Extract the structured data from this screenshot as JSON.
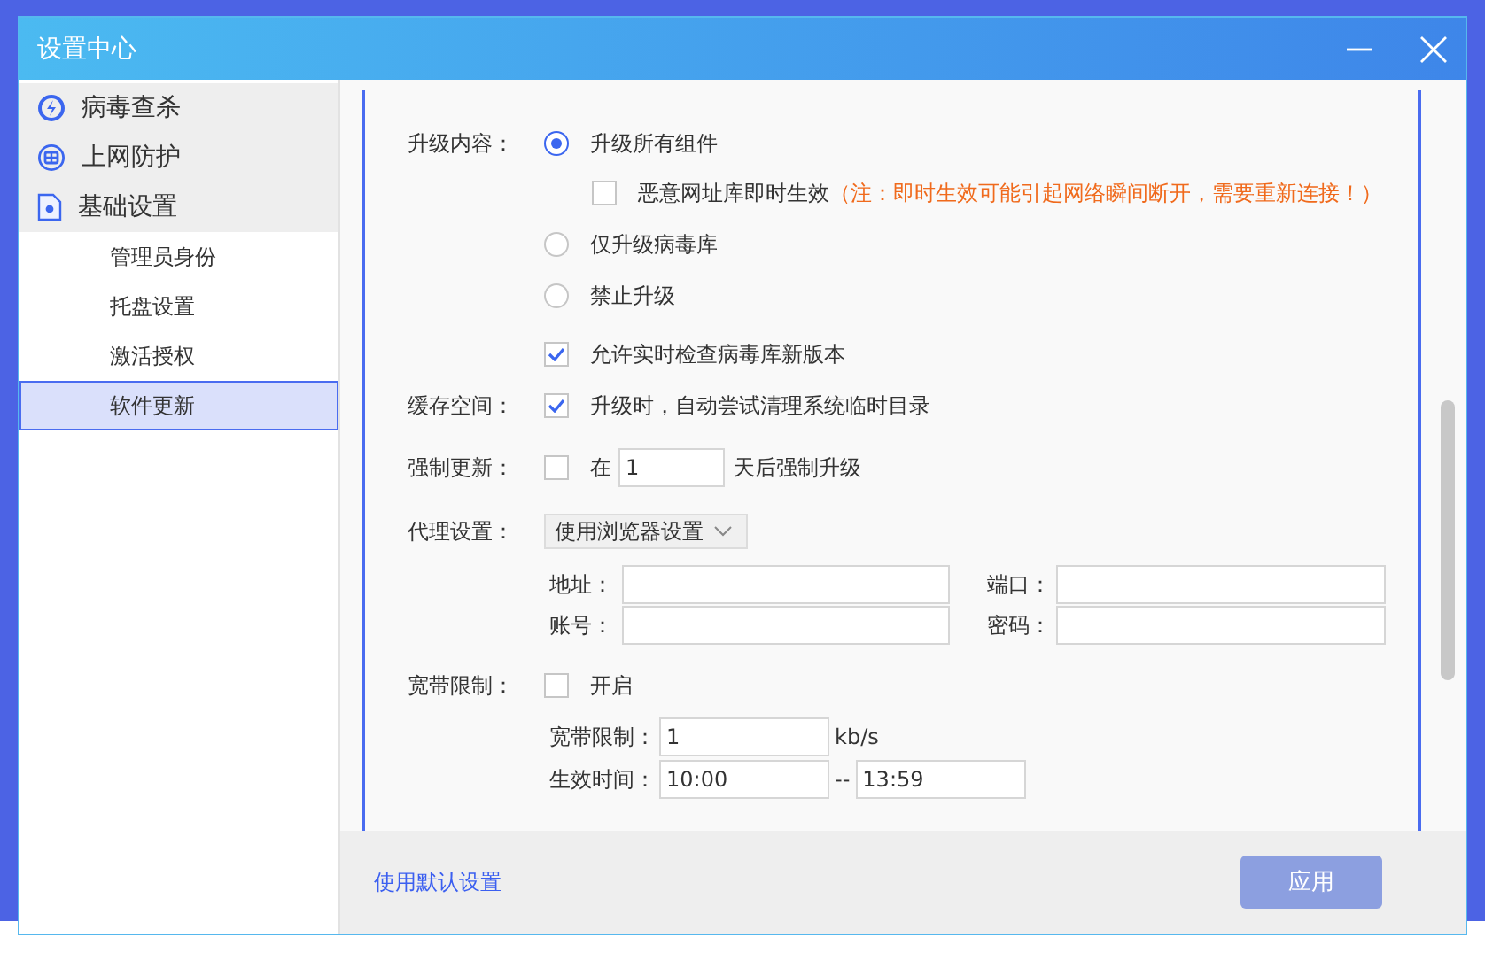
{
  "window": {
    "title": "设置中心"
  },
  "sidebar": {
    "groups": [
      {
        "label": "病毒查杀",
        "kind": "scan",
        "selected": false
      },
      {
        "label": "上网防护",
        "kind": "web",
        "selected": false
      },
      {
        "label": "基础设置",
        "kind": "basic",
        "selected": false,
        "children": [
          {
            "label": "管理员身份",
            "selected": false
          },
          {
            "label": "托盘设置",
            "selected": false
          },
          {
            "label": "激活授权",
            "selected": false
          },
          {
            "label": "软件更新",
            "selected": true
          }
        ]
      }
    ]
  },
  "upgrade_content": {
    "label": "升级内容：",
    "options": [
      {
        "label": "升级所有组件",
        "selected": true
      },
      {
        "label": "仅升级病毒库",
        "selected": false
      },
      {
        "label": "禁止升级",
        "selected": false
      }
    ],
    "realtime_url": {
      "label": "恶意网址库即时生效",
      "note": "（注：即时生效可能引起网络瞬间断开，需要重新连接！）",
      "checked": false
    },
    "realtime_check": {
      "label": "允许实时检查病毒库新版本",
      "checked": true
    }
  },
  "cache": {
    "label": "缓存空间：",
    "option": {
      "label": "升级时，自动尝试清理系统临时目录",
      "checked": true
    }
  },
  "force_update": {
    "label": "强制更新：",
    "checked": false,
    "prefix": "在",
    "days": "1",
    "suffix": "天后强制升级"
  },
  "proxy": {
    "label": "代理设置：",
    "mode": "使用浏览器设置",
    "fields": [
      {
        "label": "地址："
      },
      {
        "label": "端口："
      },
      {
        "label": "账号："
      },
      {
        "label": "密码："
      }
    ]
  },
  "bandwidth": {
    "label": "宽带限制：",
    "enable": {
      "label": "开启",
      "checked": false
    },
    "limit_label": "宽带限制：",
    "limit": "1",
    "unit": "kb/s",
    "time_label": "生效时间：",
    "start": "10:00",
    "separator": "--",
    "end": "13:59"
  },
  "footer": {
    "link": "使用默认设置",
    "apply": {
      "label": "应用",
      "disabled": true
    }
  }
}
